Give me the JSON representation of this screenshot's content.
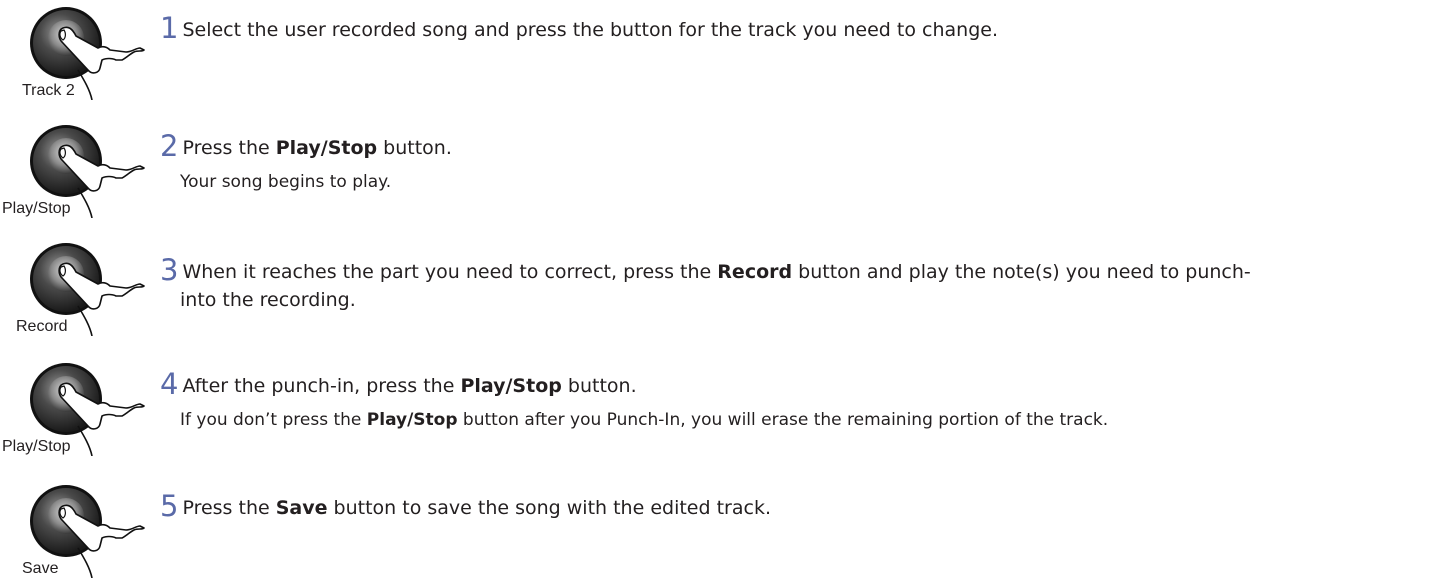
{
  "steps": [
    {
      "number": "1",
      "button_label": "Track 2",
      "text": "Select the user recorded song and press the button for the track you need to change."
    },
    {
      "number": "2",
      "button_label": "Play/Stop",
      "text_before": "Press the ",
      "bold": "Play/Stop",
      "text_after": " button.",
      "sub": "Your song begins to play."
    },
    {
      "number": "3",
      "button_label": "Record",
      "text_before": "When it reaches the part you need to correct, press the ",
      "bold": "Record",
      "text_after": " button and play the note(s) you need to punch-",
      "continuation": "into the recording."
    },
    {
      "number": "4",
      "button_label": "Play/Stop",
      "text_before": "After the punch-in, press the ",
      "bold": "Play/Stop",
      "text_after": " button.",
      "sub_before": "If you don’t press the ",
      "sub_bold": "Play/Stop",
      "sub_after": " button after you Punch-In, you will erase the remaining portion of the track."
    },
    {
      "number": "5",
      "button_label": "Save",
      "text_before": "Press the ",
      "bold": "Save",
      "text_after": " button to save the song with the edited track."
    }
  ],
  "icons": {
    "button_icon": "finger-press-button-icon"
  }
}
